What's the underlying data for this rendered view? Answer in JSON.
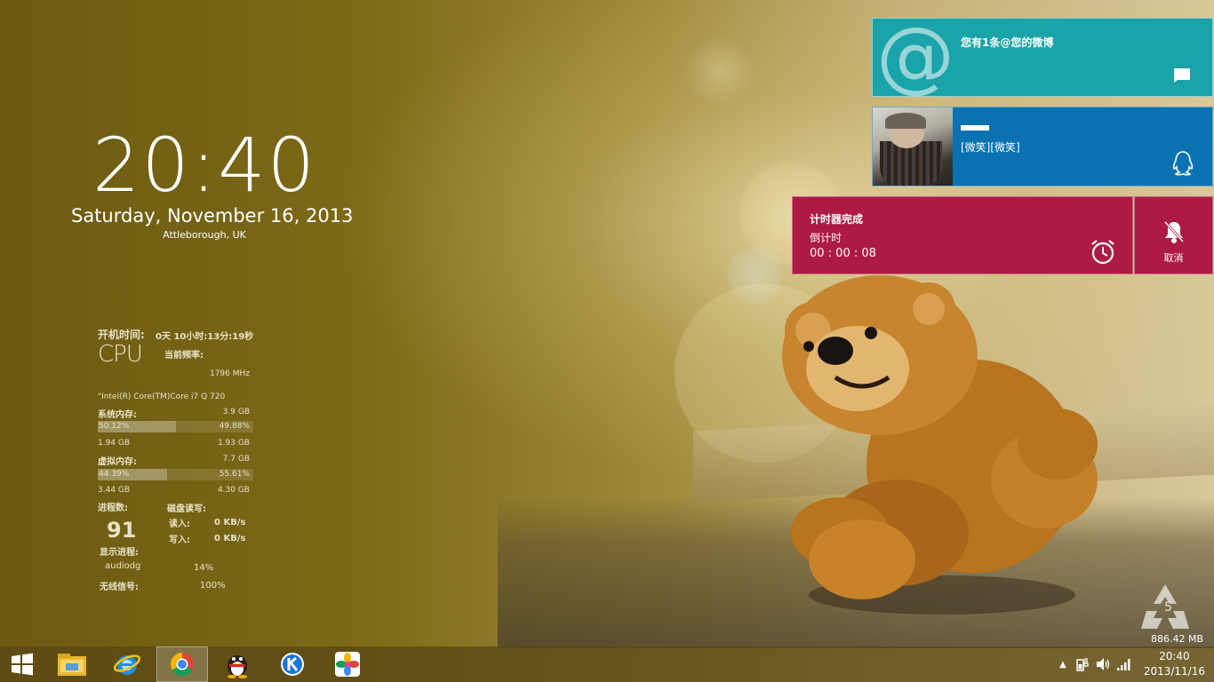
{
  "clock": {
    "time": "20:40",
    "date": "Saturday, November 16, 2013",
    "location": "Attleborough, UK"
  },
  "sysmon": {
    "uptime_label": "开机时间:",
    "uptime_value": "0天 10小时:13分:19秒",
    "cpu_logo": "CPU",
    "freq_label": "当前频率:",
    "freq_value": "1796 MHz",
    "cpu_name": "\"Intel(R) Core(TM)Core i7 Q 720",
    "mem_label": "系统内存:",
    "mem_total": "3.9 GB",
    "mem_used_pct": "50.12%",
    "mem_free_pct": "49.88%",
    "mem_used_fraction": 0.5012,
    "mem_used": "1.94 GB",
    "mem_free": "1.93 GB",
    "vmem_label": "虚拟内存:",
    "vmem_total": "7.7 GB",
    "vmem_used_pct": "44.39%",
    "vmem_free_pct": "55.61%",
    "vmem_used_fraction": 0.4439,
    "vmem_used": "3.44 GB",
    "vmem_free": "4.30 GB",
    "proc_label": "进程数:",
    "proc_count": "91",
    "disk_label": "磁盘读写:",
    "read_label": "读入:",
    "read_value": "0 KB/s",
    "write_label": "写入:",
    "write_value": "0 KB/s",
    "show_proc_label": "显示进程:",
    "proc_name": "audiodg",
    "proc_pct": "14%",
    "wifi_label": "无线信号:",
    "wifi_value": "100%"
  },
  "notifications": {
    "weibo": {
      "text": "您有1条@您的微博",
      "icon": "at-icon",
      "color": "#1aa3a8"
    },
    "qq": {
      "message": "[微笑][微笑]",
      "color": "#0a72b0"
    },
    "timer": {
      "title": "计时器完成",
      "subtitle": "倒计时",
      "time": "00 : 00 : 08",
      "cancel_label": "取消",
      "color": "#ad1b42"
    }
  },
  "recycle_bin": {
    "count": "5",
    "size": "886.42 MB"
  },
  "taskbar": {
    "apps": [
      "start-icon",
      "file-explorer-icon",
      "internet-explorer-icon",
      "chrome-icon",
      "qq-icon",
      "kugou-icon",
      "photos-icon"
    ],
    "active": "chrome-icon",
    "time": "20:40",
    "date": "2013/11/16"
  }
}
